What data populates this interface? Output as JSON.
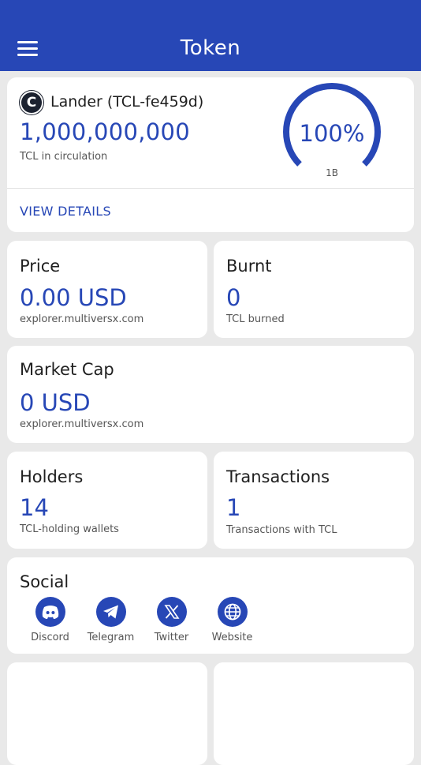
{
  "header": {
    "title": "Token"
  },
  "token": {
    "name": "Lander (TCL-fe459d)",
    "supply": "1,000,000,000",
    "supply_caption": "TCL in circulation",
    "gauge_percent": "100%",
    "gauge_fill": 1.0,
    "gauge_max_label": "1B",
    "view_details": "VIEW DETAILS"
  },
  "stats": {
    "price": {
      "label": "Price",
      "value": "0.00 USD",
      "caption": "explorer.multiversx.com"
    },
    "burnt": {
      "label": "Burnt",
      "value": "0",
      "caption": "TCL burned"
    },
    "market_cap": {
      "label": "Market Cap",
      "value": "0 USD",
      "caption": "explorer.multiversx.com"
    },
    "holders": {
      "label": "Holders",
      "value": "14",
      "caption": "TCL-holding wallets"
    },
    "transactions": {
      "label": "Transactions",
      "value": "1",
      "caption": "Transactions with TCL"
    }
  },
  "social": {
    "label": "Social",
    "items": [
      {
        "name": "Discord",
        "icon": "discord-icon"
      },
      {
        "name": "Telegram",
        "icon": "telegram-icon"
      },
      {
        "name": "Twitter",
        "icon": "x-icon"
      },
      {
        "name": "Website",
        "icon": "globe-icon"
      }
    ]
  },
  "colors": {
    "accent": "#2747b6",
    "background": "#e9e9e9",
    "card": "#ffffff"
  }
}
